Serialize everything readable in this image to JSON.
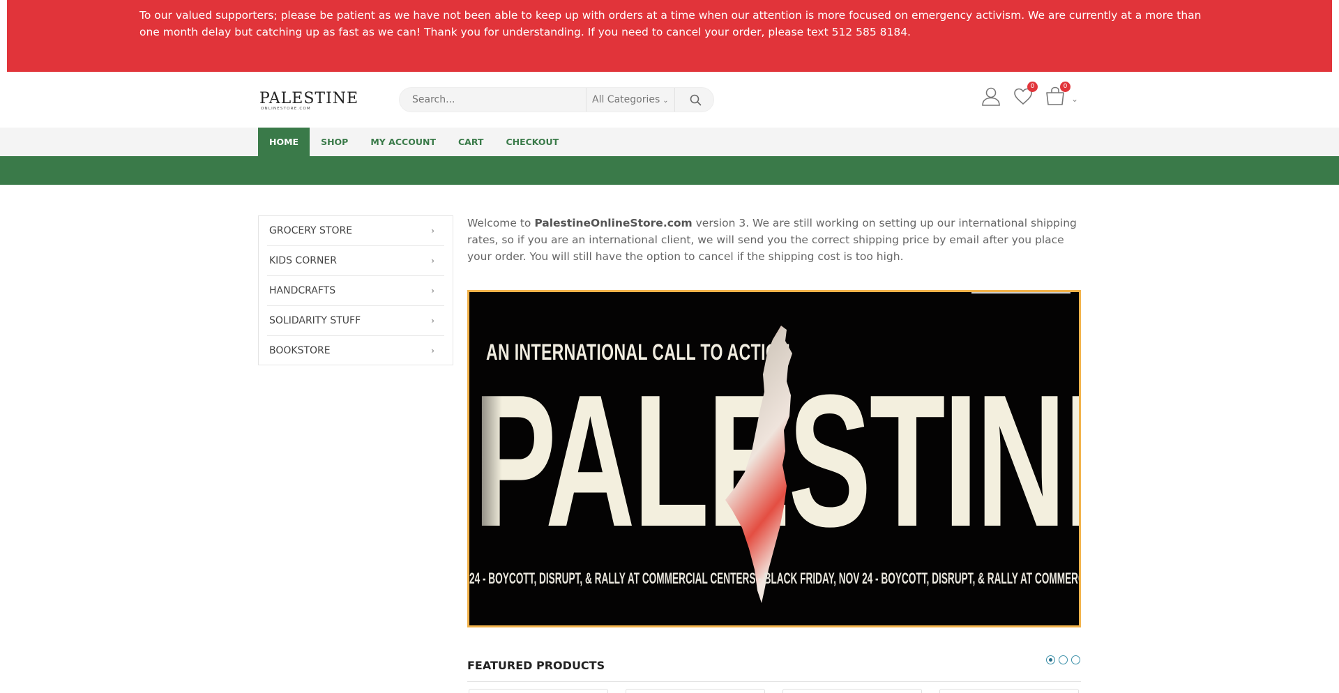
{
  "notice": {
    "text": "To our valued supporters; please be patient as we have not been able to keep up with orders at a time when our attention is more focused on emergency activism. We are currently at a more than one month delay but catching up as fast as we can! Thank you for understanding. If you need to cancel your order, please text 512 585 8184."
  },
  "header": {
    "logo_text": "PALESTINE",
    "logo_sub": "ONLINESTORE.COM",
    "search_placeholder": "Search...",
    "search_category": "All Categories",
    "wishlist_count": "0",
    "cart_count": "0"
  },
  "nav": {
    "items": [
      "HOME",
      "SHOP",
      "MY ACCOUNT",
      "CART",
      "CHECKOUT"
    ],
    "active": "HOME"
  },
  "sidebar": {
    "categories": [
      "GROCERY STORE",
      "KIDS CORNER",
      "HANDCRAFTS",
      "SOLIDARITY STUFF",
      "BOOKSTORE"
    ]
  },
  "intro": {
    "prefix": "Welcome to ",
    "site": "PalestineOnlineStore.com",
    "suffix": " version 3. We are still working on setting up our international shipping rates, so if you are an international client, we will send you the correct shipping price by email after you place your order. You will still have the option to cancel if the shipping cost is too high."
  },
  "banner": {
    "call_to_action": "AN INTERNATIONAL CALL TO ACTION",
    "headline": "PALESTINE!",
    "ticker": "24 -   BOYCOTT, DISRUPT, & RALLY AT COMMERCIAL CENTERS   - BLACK FRIDAY, NOV 24 -   BOYCOTT, DISRUPT, & RALLY AT COMMERCIAL CENTERS   - BLA"
  },
  "featured": {
    "title": "FEATURED PRODUCTS",
    "slides": 3,
    "active_slide": 1
  },
  "colors": {
    "notice_bg": "#e1343a",
    "brand_green": "#3a7a49",
    "banner_border": "#f2b24a",
    "badge_red": "#e1343a"
  },
  "icons": [
    "search-icon",
    "user-icon",
    "heart-icon",
    "cart-icon",
    "chevron-down-icon",
    "chevron-right-icon"
  ]
}
